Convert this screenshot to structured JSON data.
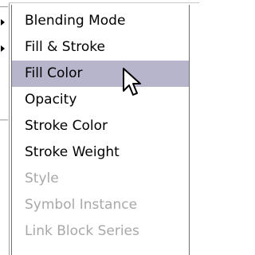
{
  "submenu": {
    "items": [
      {
        "label": "Blending Mode",
        "state": "normal"
      },
      {
        "label": "Fill & Stroke",
        "state": "normal"
      },
      {
        "label": "Fill Color",
        "state": "highlighted"
      },
      {
        "label": "Opacity",
        "state": "normal"
      },
      {
        "label": "Stroke Color",
        "state": "normal"
      },
      {
        "label": "Stroke Weight",
        "state": "normal"
      },
      {
        "label": "Style",
        "state": "disabled"
      },
      {
        "label": "Symbol Instance",
        "state": "disabled"
      },
      {
        "label": "Link Block Series",
        "state": "disabled"
      }
    ]
  },
  "colors": {
    "highlight": "#b7b5cc",
    "disabled_text": "#a8a8a8",
    "text": "#000000"
  },
  "icons": {
    "cursor": "arrow-cursor-icon",
    "submenu_arrow": "submenu-arrow-icon"
  }
}
